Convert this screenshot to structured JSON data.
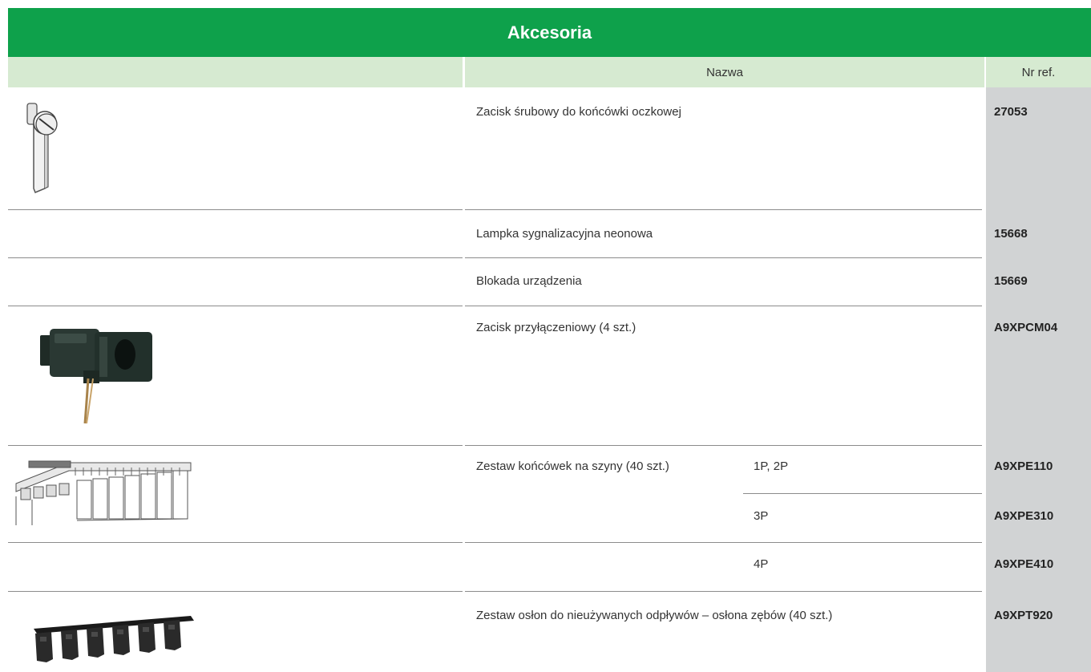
{
  "table": {
    "title": "Akcesoria",
    "headers": {
      "name": "Nazwa",
      "ref": "Nr ref."
    },
    "rows": [
      {
        "name": "Zacisk śrubowy do końcówki oczkowej",
        "ref": "27053",
        "icon": "screw-terminal-icon"
      },
      {
        "name": "Lampka sygnalizacyjna neonowa",
        "ref": "15668"
      },
      {
        "name": "Blokada urządzenia",
        "ref": "15669"
      },
      {
        "name": "Zacisk przyłączeniowy (4 szt.)",
        "ref": "A9XPCM04",
        "icon": "connection-clamp-icon"
      },
      {
        "name": "Zestaw końcówek na szyny (40 szt.)",
        "icon": "busbar-end-kit-icon",
        "variants": [
          {
            "label": "1P, 2P",
            "ref": "A9XPE110"
          },
          {
            "label": "3P",
            "ref": "A9XPE310"
          },
          {
            "label": "4P",
            "ref": "A9XPE410"
          }
        ]
      },
      {
        "name": "Zestaw osłon do nieużywanych odpływów – osłona zębów (40 szt.)",
        "ref": "A9XPT920",
        "icon": "tooth-cover-icon"
      }
    ]
  },
  "colors": {
    "title_bg": "#0ea14b",
    "header_bg": "#d6ead1",
    "ref_col_bg": "#d1d3d4"
  }
}
